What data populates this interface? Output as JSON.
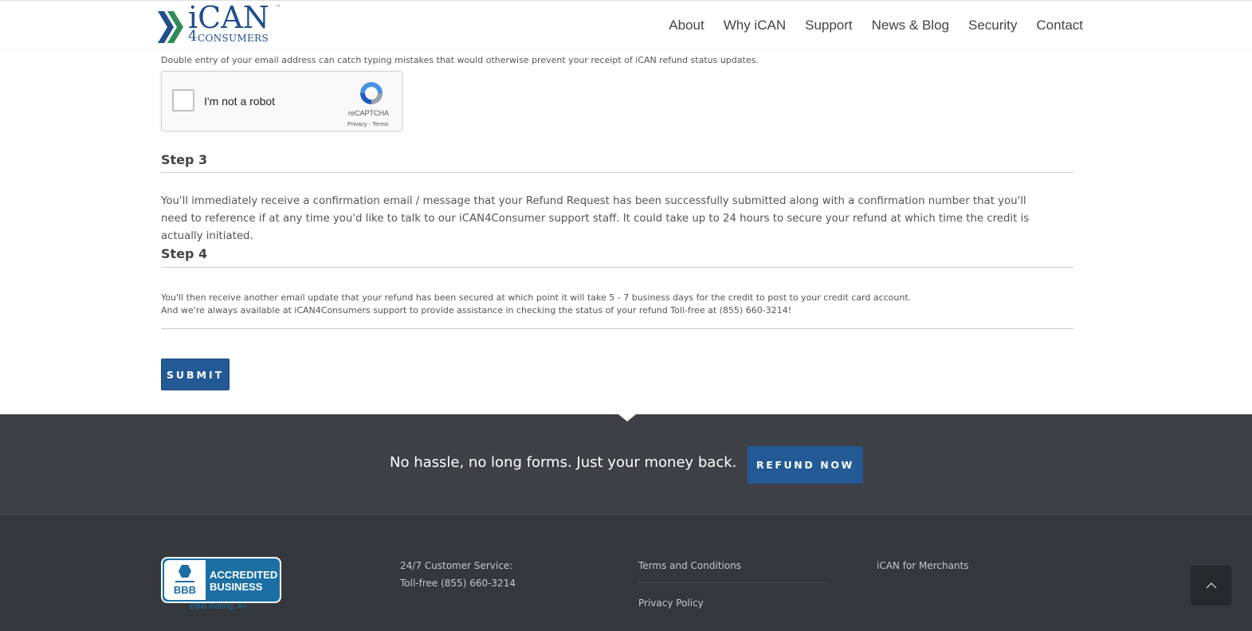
{
  "brand": {
    "logo_text": "iCAN",
    "logo_sub_four": "4",
    "logo_sub": "CONSUMERS",
    "tm": "™"
  },
  "nav": [
    "About",
    "Why iCAN",
    "Support",
    "News & Blog",
    "Security",
    "Contact"
  ],
  "form": {
    "email_hint": "Double entry of your email address can catch typing mistakes that would otherwise prevent your receipt of iCAN refund status updates.",
    "captcha": {
      "label": "I'm not a robot",
      "brand": "reCAPTCHA",
      "links": "Privacy - Terms"
    },
    "step3": {
      "title": "Step 3",
      "text": "You'll immediately receive a confirmation email / message that your Refund Request has been successfully submitted along with a confirmation number that you'll need to reference if at any time you'd like to talk to our iCAN4Consumer support staff. It could take up to 24 hours to secure your refund at which time the credit is actually initiated."
    },
    "step4": {
      "title": "Step 4",
      "line1": "You'll then receive another email update that your refund has been secured at which point it will take 5 - 7 business days for the credit to post to your credit card account.",
      "line2": "And we're always available at iCAN4Consumers support to provide assistance in checking the status of your refund Toll-free at (855) 660-3214!"
    },
    "submit_label": "SUBMIT"
  },
  "callout": {
    "tagline": "No hassle, no long forms. Just your money back.",
    "button": "REFUND NOW"
  },
  "footer": {
    "bbb": {
      "line1": "ACCREDITED",
      "line2": "BUSINESS",
      "seal_text": "BBB",
      "rating": "BBB Rating: A+"
    },
    "service_label": "24/7 Customer Service:",
    "service_phone": "Toll-free (855) 660-3214",
    "terms": "Terms and Conditions",
    "privacy": "Privacy Policy",
    "merchants": "iCAN for Merchants"
  },
  "colors": {
    "brand_blue": "#235a95",
    "dark_band": "#3d4147",
    "footer_bg": "#34373c"
  }
}
